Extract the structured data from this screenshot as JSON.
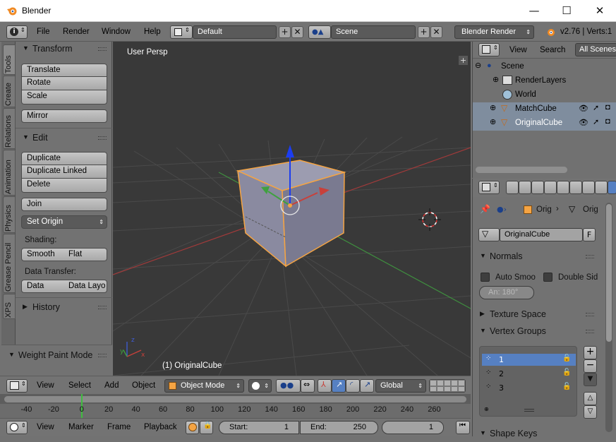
{
  "window": {
    "title": "Blender",
    "minimize": "—",
    "maximize": "☐",
    "close": "✕"
  },
  "info_header": {
    "menus": [
      "File",
      "Render",
      "Window",
      "Help"
    ],
    "screen_layout": "Default",
    "scene": "Scene",
    "render_engine": "Blender Render",
    "version": "v2.76 | Verts:1"
  },
  "tool_tabs": [
    "Tools",
    "Create",
    "Relations",
    "Animation",
    "Physics",
    "Grease Pencil",
    "XPS"
  ],
  "tool_shelf": {
    "transform_title": "Transform",
    "translate": "Translate",
    "rotate": "Rotate",
    "scale": "Scale",
    "mirror": "Mirror",
    "edit_title": "Edit",
    "duplicate": "Duplicate",
    "duplicate_linked": "Duplicate Linked",
    "delete": "Delete",
    "join": "Join",
    "set_origin": "Set Origin",
    "shading_label": "Shading:",
    "smooth": "Smooth",
    "flat": "Flat",
    "data_transfer_label": "Data Transfer:",
    "data": "Data",
    "data_layout": "Data Layo",
    "history_title": "History",
    "weight_paint_mode": "Weight Paint Mode"
  },
  "viewport": {
    "view_label": "User Persp",
    "object_label": "(1) OriginalCube",
    "plus": "+",
    "axis_x": "x",
    "axis_y": "y",
    "axis_z": "z"
  },
  "view3d_header": {
    "menus": [
      "View",
      "Select",
      "Add",
      "Object"
    ],
    "mode": "Object Mode",
    "orientation": "Global"
  },
  "timeline": {
    "ticks": [
      "-40",
      "-20",
      "0",
      "20",
      "40",
      "60",
      "80",
      "100",
      "120",
      "140",
      "160",
      "180",
      "200",
      "220",
      "240",
      "260"
    ],
    "current_frame_marker": 0
  },
  "timeline_header": {
    "menus": [
      "View",
      "Marker",
      "Frame",
      "Playback"
    ],
    "start_label": "Start:",
    "start_value": "1",
    "end_label": "End:",
    "end_value": "250",
    "current_value": "1"
  },
  "outliner": {
    "view": "View",
    "search": "Search",
    "all_scenes": "All Scenes",
    "items": [
      {
        "label": "Scene"
      },
      {
        "label": "RenderLayers"
      },
      {
        "label": "World"
      },
      {
        "label": "MatchCube"
      },
      {
        "label": "OriginalCube"
      }
    ]
  },
  "properties": {
    "breadcrumb_object1": "Orig",
    "breadcrumb_object2": "Orig",
    "object_name": "OriginalCube",
    "fake_user": "F",
    "normals_title": "Normals",
    "auto_smooth": "Auto Smoo",
    "double_sided": "Double Sid",
    "angle": "An: 180°",
    "texture_space_title": "Texture Space",
    "vertex_groups_title": "Vertex Groups",
    "vertex_groups": [
      "1",
      "2",
      "3"
    ],
    "shape_keys_title": "Shape Keys"
  },
  "colors": {
    "selection_orange": "#f5a443",
    "axis_red": "#c8403a",
    "axis_green": "#3fa13f",
    "gizmo_blue": "#1c3df0",
    "vgroup_selected": "#5680c2"
  }
}
